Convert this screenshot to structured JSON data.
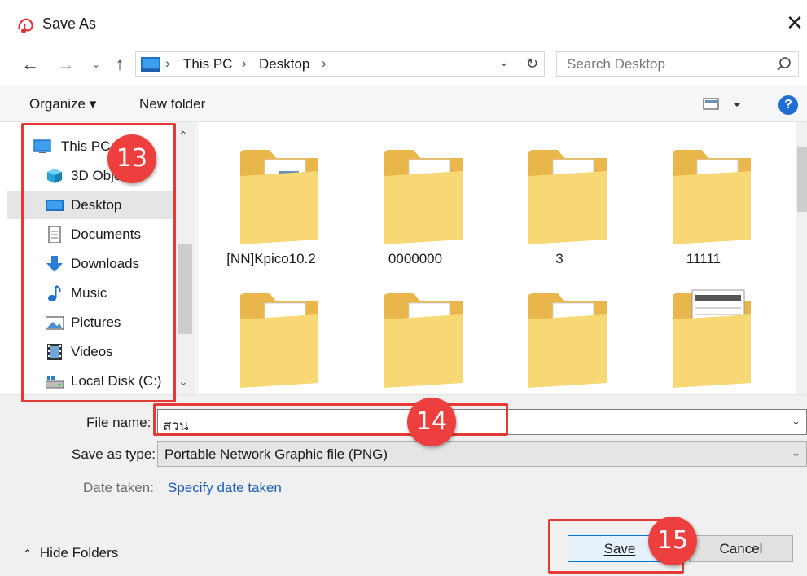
{
  "window": {
    "title": "Save As",
    "close_glyph": "✕"
  },
  "address": {
    "crumbs": [
      "This PC",
      "Desktop"
    ],
    "search_placeholder": "Search Desktop"
  },
  "toolbar": {
    "organize": "Organize ▾",
    "new_folder": "New folder",
    "help": "?"
  },
  "nav": {
    "items": [
      {
        "label": "This PC",
        "icon": "computer-icon"
      },
      {
        "label": "3D Objects",
        "icon": "cube-3d-icon"
      },
      {
        "label": "Desktop",
        "icon": "desktop-icon",
        "selected": true
      },
      {
        "label": "Documents",
        "icon": "document-icon"
      },
      {
        "label": "Downloads",
        "icon": "download-arrow-icon"
      },
      {
        "label": "Music",
        "icon": "music-note-icon"
      },
      {
        "label": "Pictures",
        "icon": "pictures-icon"
      },
      {
        "label": "Videos",
        "icon": "film-icon"
      },
      {
        "label": "Local Disk (C:)",
        "icon": "drive-icon"
      }
    ]
  },
  "files": [
    {
      "label": "[NN]Kpico10.2",
      "kind": "folder-doc"
    },
    {
      "label": "0000000",
      "kind": "folder-word"
    },
    {
      "label": "3",
      "kind": "folder-excel"
    },
    {
      "label": "11111",
      "kind": "folder-excel"
    },
    {
      "label": "",
      "kind": "folder-excel"
    },
    {
      "label": "",
      "kind": "folder-word"
    },
    {
      "label": "",
      "kind": "folder-edge"
    },
    {
      "label": "",
      "kind": "folder-papers"
    }
  ],
  "form": {
    "file_name_label": "File name:",
    "file_name_value": "สวน",
    "save_type_label": "Save as type:",
    "save_type_value": "Portable Network Graphic file (PNG)",
    "date_label": "Date taken:",
    "date_link": "Specify date taken",
    "hide_folders": "Hide Folders",
    "save": "Save",
    "cancel": "Cancel"
  },
  "annotations": {
    "step_nav": "13",
    "step_filename": "14",
    "step_save": "15"
  },
  "colors": {
    "accent": "#0078d7",
    "annotation_red": "#e53935",
    "badge_red": "#ee3f3f",
    "link": "#1a5fb4"
  }
}
